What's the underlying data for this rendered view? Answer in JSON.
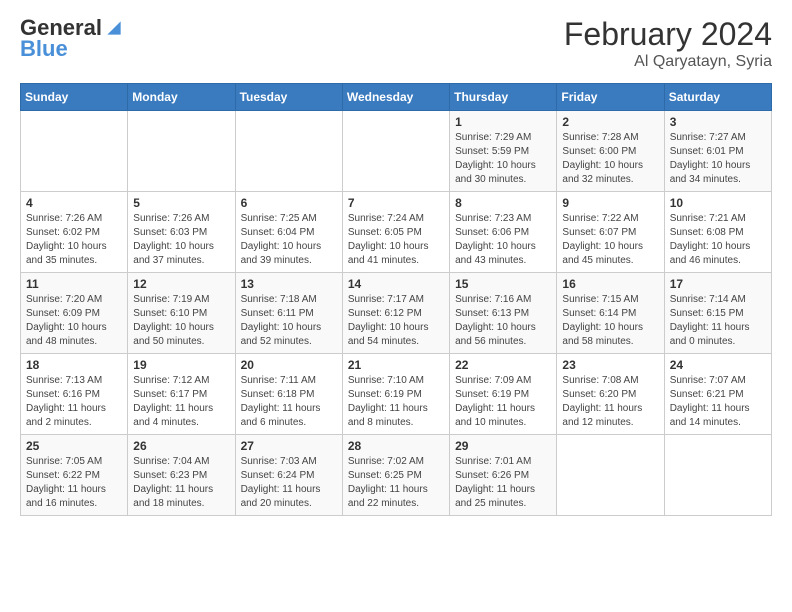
{
  "header": {
    "logo_line1": "General",
    "logo_line2": "Blue",
    "month": "February 2024",
    "location": "Al Qaryatayn, Syria"
  },
  "weekdays": [
    "Sunday",
    "Monday",
    "Tuesday",
    "Wednesday",
    "Thursday",
    "Friday",
    "Saturday"
  ],
  "weeks": [
    [
      {
        "day": "",
        "info": ""
      },
      {
        "day": "",
        "info": ""
      },
      {
        "day": "",
        "info": ""
      },
      {
        "day": "",
        "info": ""
      },
      {
        "day": "1",
        "info": "Sunrise: 7:29 AM\nSunset: 5:59 PM\nDaylight: 10 hours and 30 minutes."
      },
      {
        "day": "2",
        "info": "Sunrise: 7:28 AM\nSunset: 6:00 PM\nDaylight: 10 hours and 32 minutes."
      },
      {
        "day": "3",
        "info": "Sunrise: 7:27 AM\nSunset: 6:01 PM\nDaylight: 10 hours and 34 minutes."
      }
    ],
    [
      {
        "day": "4",
        "info": "Sunrise: 7:26 AM\nSunset: 6:02 PM\nDaylight: 10 hours and 35 minutes."
      },
      {
        "day": "5",
        "info": "Sunrise: 7:26 AM\nSunset: 6:03 PM\nDaylight: 10 hours and 37 minutes."
      },
      {
        "day": "6",
        "info": "Sunrise: 7:25 AM\nSunset: 6:04 PM\nDaylight: 10 hours and 39 minutes."
      },
      {
        "day": "7",
        "info": "Sunrise: 7:24 AM\nSunset: 6:05 PM\nDaylight: 10 hours and 41 minutes."
      },
      {
        "day": "8",
        "info": "Sunrise: 7:23 AM\nSunset: 6:06 PM\nDaylight: 10 hours and 43 minutes."
      },
      {
        "day": "9",
        "info": "Sunrise: 7:22 AM\nSunset: 6:07 PM\nDaylight: 10 hours and 45 minutes."
      },
      {
        "day": "10",
        "info": "Sunrise: 7:21 AM\nSunset: 6:08 PM\nDaylight: 10 hours and 46 minutes."
      }
    ],
    [
      {
        "day": "11",
        "info": "Sunrise: 7:20 AM\nSunset: 6:09 PM\nDaylight: 10 hours and 48 minutes."
      },
      {
        "day": "12",
        "info": "Sunrise: 7:19 AM\nSunset: 6:10 PM\nDaylight: 10 hours and 50 minutes."
      },
      {
        "day": "13",
        "info": "Sunrise: 7:18 AM\nSunset: 6:11 PM\nDaylight: 10 hours and 52 minutes."
      },
      {
        "day": "14",
        "info": "Sunrise: 7:17 AM\nSunset: 6:12 PM\nDaylight: 10 hours and 54 minutes."
      },
      {
        "day": "15",
        "info": "Sunrise: 7:16 AM\nSunset: 6:13 PM\nDaylight: 10 hours and 56 minutes."
      },
      {
        "day": "16",
        "info": "Sunrise: 7:15 AM\nSunset: 6:14 PM\nDaylight: 10 hours and 58 minutes."
      },
      {
        "day": "17",
        "info": "Sunrise: 7:14 AM\nSunset: 6:15 PM\nDaylight: 11 hours and 0 minutes."
      }
    ],
    [
      {
        "day": "18",
        "info": "Sunrise: 7:13 AM\nSunset: 6:16 PM\nDaylight: 11 hours and 2 minutes."
      },
      {
        "day": "19",
        "info": "Sunrise: 7:12 AM\nSunset: 6:17 PM\nDaylight: 11 hours and 4 minutes."
      },
      {
        "day": "20",
        "info": "Sunrise: 7:11 AM\nSunset: 6:18 PM\nDaylight: 11 hours and 6 minutes."
      },
      {
        "day": "21",
        "info": "Sunrise: 7:10 AM\nSunset: 6:19 PM\nDaylight: 11 hours and 8 minutes."
      },
      {
        "day": "22",
        "info": "Sunrise: 7:09 AM\nSunset: 6:19 PM\nDaylight: 11 hours and 10 minutes."
      },
      {
        "day": "23",
        "info": "Sunrise: 7:08 AM\nSunset: 6:20 PM\nDaylight: 11 hours and 12 minutes."
      },
      {
        "day": "24",
        "info": "Sunrise: 7:07 AM\nSunset: 6:21 PM\nDaylight: 11 hours and 14 minutes."
      }
    ],
    [
      {
        "day": "25",
        "info": "Sunrise: 7:05 AM\nSunset: 6:22 PM\nDaylight: 11 hours and 16 minutes."
      },
      {
        "day": "26",
        "info": "Sunrise: 7:04 AM\nSunset: 6:23 PM\nDaylight: 11 hours and 18 minutes."
      },
      {
        "day": "27",
        "info": "Sunrise: 7:03 AM\nSunset: 6:24 PM\nDaylight: 11 hours and 20 minutes."
      },
      {
        "day": "28",
        "info": "Sunrise: 7:02 AM\nSunset: 6:25 PM\nDaylight: 11 hours and 22 minutes."
      },
      {
        "day": "29",
        "info": "Sunrise: 7:01 AM\nSunset: 6:26 PM\nDaylight: 11 hours and 25 minutes."
      },
      {
        "day": "",
        "info": ""
      },
      {
        "day": "",
        "info": ""
      }
    ]
  ]
}
